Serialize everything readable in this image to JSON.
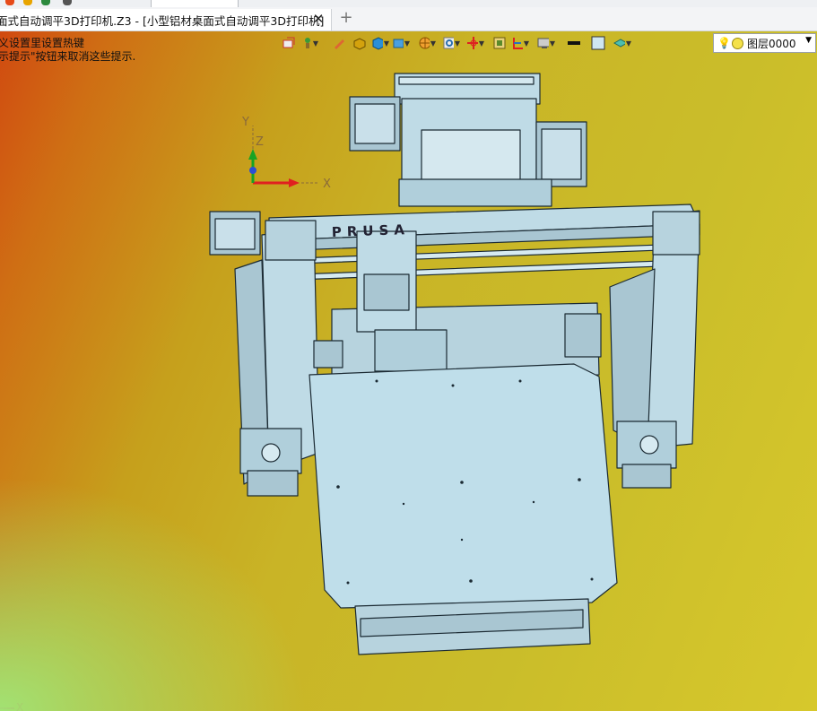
{
  "document_tab": {
    "title": "面式自动调平3D打印机.Z3 - [小型铝材桌面式自动调平3D打印机]",
    "close_glyph": "✕",
    "new_tab_glyph": "+"
  },
  "viewport": {
    "hint_line1": "义设置里设置热键",
    "hint_line2": "示提示\"按钮来取消这些提示.",
    "brand_text_on_model": "PRUSA",
    "axis_triad": {
      "x_label": "X",
      "y_label": "Y",
      "z_label": "Z"
    },
    "corner_axis_label": "X"
  },
  "view_toolbar": {
    "icons": [
      "snap-icon",
      "pencil-icon",
      "cube-shaded-icon",
      "view-cube-icon",
      "render-mode-icon",
      "zoom-fit-icon",
      "pivot-icon",
      "frame-icon",
      "section-icon",
      "display-icon",
      "line-style-icon",
      "color-box-icon",
      "layer-stack-icon"
    ]
  },
  "layer_selector": {
    "bulb": "💡",
    "value": "图层0000",
    "arrow": "▼"
  },
  "colors": {
    "model_fill": "#bfdbe6",
    "model_edge": "#1b2a33",
    "accent_red": "#e02020"
  }
}
